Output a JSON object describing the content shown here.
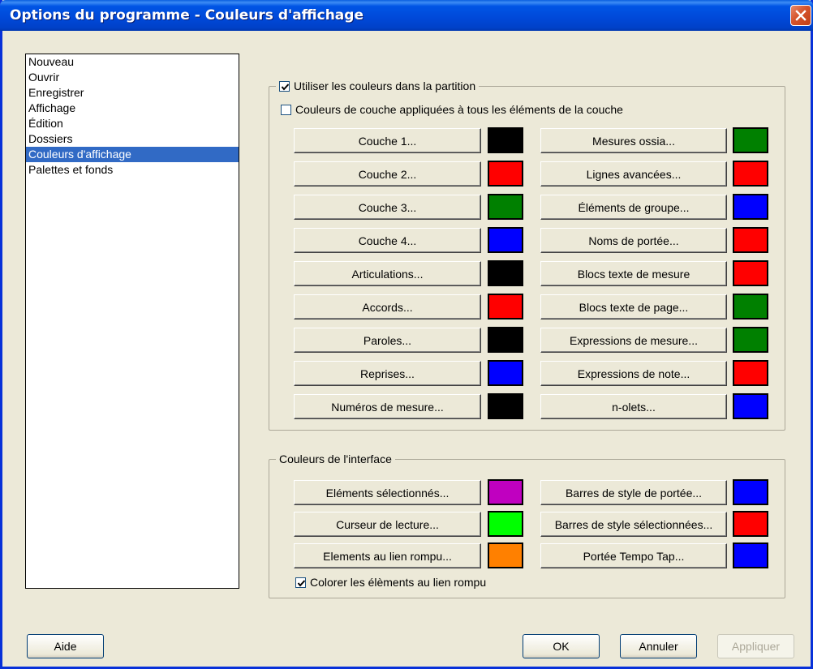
{
  "window": {
    "title": "Options du programme - Couleurs d'affichage"
  },
  "sidebar": {
    "items": [
      {
        "label": "Nouveau",
        "selected": false
      },
      {
        "label": "Ouvrir",
        "selected": false
      },
      {
        "label": "Enregistrer",
        "selected": false
      },
      {
        "label": "Affichage",
        "selected": false
      },
      {
        "label": "Édition",
        "selected": false
      },
      {
        "label": "Dossiers",
        "selected": false
      },
      {
        "label": "Couleurs d'affichage",
        "selected": true
      },
      {
        "label": "Palettes et fonds",
        "selected": false
      }
    ]
  },
  "score_colors": {
    "use_colors_label": "Utiliser les couleurs dans la partition",
    "use_colors_checked": true,
    "layer_all_label": "Couleurs de couche appliquées à tous les éléments de la couche",
    "layer_all_checked": false,
    "left": [
      {
        "label": "Couche 1...",
        "color": "#000000"
      },
      {
        "label": "Couche 2...",
        "color": "#ff0000"
      },
      {
        "label": "Couche 3...",
        "color": "#008000"
      },
      {
        "label": "Couche 4...",
        "color": "#0000ff"
      },
      {
        "label": "Articulations...",
        "color": "#000000"
      },
      {
        "label": "Accords...",
        "color": "#ff0000"
      },
      {
        "label": "Paroles...",
        "color": "#000000"
      },
      {
        "label": "Reprises...",
        "color": "#0000ff"
      },
      {
        "label": "Numéros de mesure...",
        "color": "#000000"
      }
    ],
    "right": [
      {
        "label": "Mesures ossia...",
        "color": "#008000"
      },
      {
        "label": "Lignes avancées...",
        "color": "#ff0000"
      },
      {
        "label": "Éléments de groupe...",
        "color": "#0000ff"
      },
      {
        "label": "Noms de portée...",
        "color": "#ff0000"
      },
      {
        "label": "Blocs texte de mesure",
        "color": "#ff0000"
      },
      {
        "label": "Blocs texte de page...",
        "color": "#008000"
      },
      {
        "label": "Expressions de mesure...",
        "color": "#008000"
      },
      {
        "label": "Expressions de note...",
        "color": "#ff0000"
      },
      {
        "label": "n-olets...",
        "color": "#0000ff"
      }
    ]
  },
  "interface_colors": {
    "legend": "Couleurs de l'interface",
    "left": [
      {
        "label": "Eléments sélectionnés...",
        "color": "#c000c0"
      },
      {
        "label": "Curseur de lecture...",
        "color": "#00ff00"
      },
      {
        "label": "Elements au lien rompu...",
        "color": "#ff8000"
      }
    ],
    "right": [
      {
        "label": "Barres de style de portée...",
        "color": "#0000ff"
      },
      {
        "label": "Barres de style sélectionnées...",
        "color": "#ff0000"
      },
      {
        "label": "Portée Tempo Tap...",
        "color": "#0000ff"
      }
    ],
    "broken_link_label": "Colorer les élèments au lien rompu",
    "broken_link_checked": true
  },
  "footer": {
    "help_label": "Aide",
    "ok_label": "OK",
    "cancel_label": "Annuler",
    "apply_label": "Appliquer"
  }
}
